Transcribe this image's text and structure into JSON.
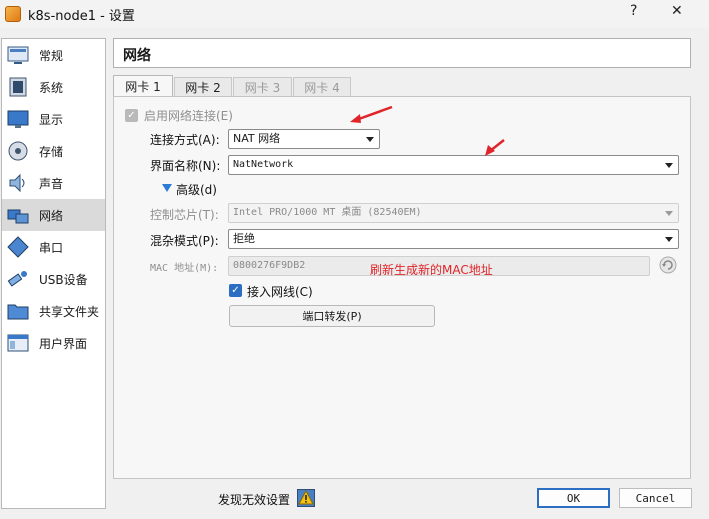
{
  "window": {
    "title": "k8s-node1 - 设置",
    "help": "?",
    "close": "✕"
  },
  "sidebar": {
    "items": [
      {
        "label": "常规"
      },
      {
        "label": "系统"
      },
      {
        "label": "显示"
      },
      {
        "label": "存储"
      },
      {
        "label": "声音"
      },
      {
        "label": "网络"
      },
      {
        "label": "串口"
      },
      {
        "label": "USB设备"
      },
      {
        "label": "共享文件夹"
      },
      {
        "label": "用户界面"
      }
    ],
    "selected_index": 5
  },
  "page": {
    "title": "网络"
  },
  "tabs": [
    {
      "label": "网卡 1",
      "active": true
    },
    {
      "label": "网卡 2",
      "active": false
    },
    {
      "label": "网卡 3",
      "disabled": true
    },
    {
      "label": "网卡 4",
      "disabled": true
    }
  ],
  "adapter": {
    "enable_label": "启用网络连接(E)",
    "enable_checked": true,
    "attached_label": "连接方式(A):",
    "attached_value": "NAT 网络",
    "name_label": "界面名称(N):",
    "name_value": "NatNetwork",
    "advanced_label": "高级(d)",
    "chip_label": "控制芯片(T):",
    "chip_value": "Intel PRO/1000 MT 桌面 (82540EM)",
    "promisc_label": "混杂模式(P):",
    "promisc_value": "拒绝",
    "mac_label": "MAC 地址(M):",
    "mac_value": "0800276F9DB2",
    "mac_note": "刷新生成新的MAC地址",
    "cable_label": "接入网线(C)",
    "cable_checked": true,
    "port_forward_label": "端口转发(P)"
  },
  "footer": {
    "invalid_label": "发现无效设置",
    "ok_label": "OK",
    "cancel_label": "Cancel"
  },
  "colors": {
    "accent": "#2c6fc2",
    "annotation": "#e0242a"
  }
}
